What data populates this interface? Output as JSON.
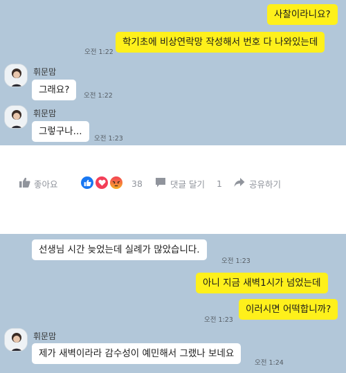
{
  "chat_top": {
    "messages": [
      {
        "text": "사찰이라니요?"
      },
      {
        "text": "학기초에 비상연락망 작성해서 번호 다 나와있는데",
        "time": "오전 1:22"
      },
      {
        "sender": "휘문맘",
        "text": "그래요?",
        "time": "오전 1:22"
      },
      {
        "sender": "휘문맘",
        "text": "그렇구나...",
        "time": "오전 1:23"
      }
    ]
  },
  "facebook_bar": {
    "like_label": "좋아요",
    "reaction_count": "38",
    "comment_label": "댓글 달기",
    "comment_count": "1",
    "share_label": "공유하기"
  },
  "chat_bottom": {
    "messages": [
      {
        "text": "선생님 시간 늦었는데 실례가 많았습니다.",
        "time": "오전 1:23"
      },
      {
        "text": "아니 지금 새벽1시가 넘었는데"
      },
      {
        "text": "이러시면 어떡합니까?",
        "time": "오전 1:23"
      },
      {
        "sender": "휘문맘",
        "text": "제가 새벽이라라 감수성이 예민해서 그랬나 보네요",
        "time": "오전 1:24"
      }
    ]
  },
  "colors": {
    "chat_background": "#b2c7d9",
    "my_bubble": "#fef01b",
    "their_bubble": "#ffffff",
    "like_blue": "#1877f2",
    "heart_red": "#f33e58",
    "angry_orange": "#f7714b"
  },
  "icons": [
    "avatar-icon",
    "thumbs-up-icon",
    "like-reaction-icon",
    "heart-reaction-icon",
    "angry-reaction-icon",
    "comment-icon",
    "share-icon"
  ]
}
